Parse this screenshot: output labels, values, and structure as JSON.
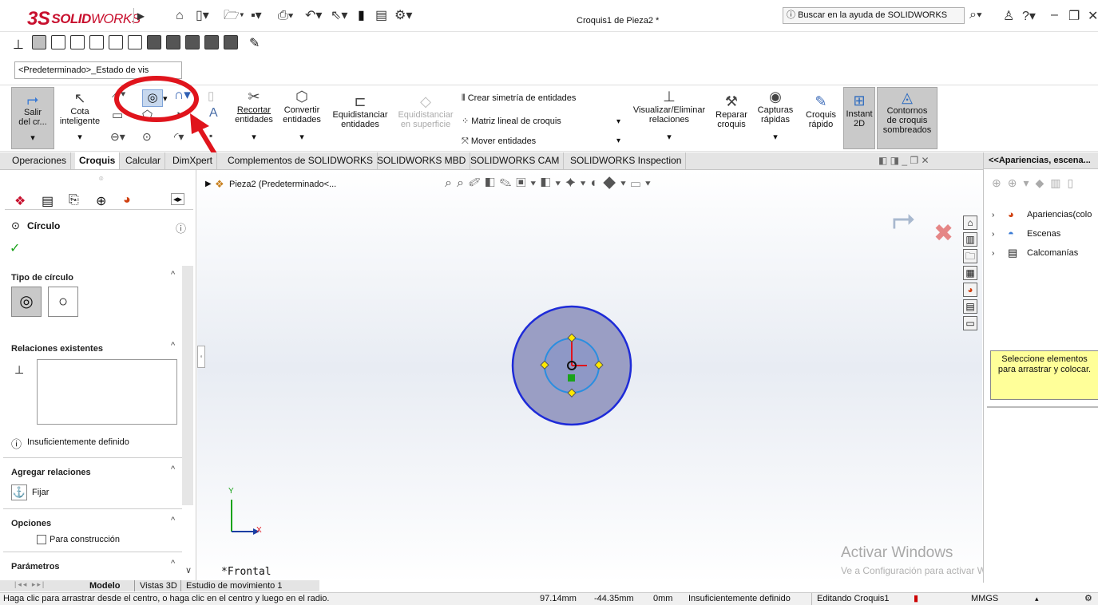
{
  "titlebar": {
    "logo_ds": "3S",
    "logo_solid": "SOLID",
    "logo_works": "WORKS",
    "document_title": "Croquis1 de Pieza2 *",
    "help_search_placeholder": "Buscar en la ayuda de SOLIDWORKS"
  },
  "config_selector": {
    "value": "<Predeterminado>_Estado de vis"
  },
  "ribbon": {
    "salir_croquis": [
      "Salir",
      "del cr..."
    ],
    "cota_inteligente": [
      "Cota",
      "inteligente"
    ],
    "recortar": [
      "Recortar",
      "entidades"
    ],
    "convertir": [
      "Convertir",
      "entidades"
    ],
    "equidistanciar": [
      "Equidistanciar",
      "entidades"
    ],
    "equidistanciar_superficie": [
      "Equidistanciar",
      "en superficie"
    ],
    "simetria": "Crear simetría de entidades",
    "matriz": "Matriz lineal de croquis",
    "mover": "Mover entidades",
    "visualizar": [
      "Visualizar/Eliminar",
      "relaciones"
    ],
    "reparar": [
      "Reparar",
      "croquis"
    ],
    "capturas": [
      "Capturas",
      "rápidas"
    ],
    "croquis_rapido": [
      "Croquis",
      "rápido"
    ],
    "instant2d": [
      "Instant",
      "2D"
    ],
    "contornos": [
      "Contornos",
      "de croquis",
      "sombreados"
    ]
  },
  "tabs": [
    "Operaciones",
    "Croquis",
    "Calcular",
    "DimXpert",
    "Complementos de SOLIDWORKS",
    "SOLIDWORKS MBD",
    "SOLIDWORKS CAM",
    "SOLIDWORKS Inspection"
  ],
  "active_tab": "Croquis",
  "property_manager": {
    "title": "Círculo",
    "tipo_circulo": "Tipo de círculo",
    "relaciones_existentes": "Relaciones existentes",
    "estado": "Insuficientemente definido",
    "agregar_relaciones": "Agregar relaciones",
    "fijar": "Fijar",
    "opciones": "Opciones",
    "para_construccion": "Para construcción",
    "parametros": "Parámetros"
  },
  "viewport": {
    "tree_item": "Pieza2  (Predeterminado<...",
    "view_label": "*Frontal",
    "axis_x": "X",
    "axis_y": "Y",
    "watermark_title": "Activar Windows",
    "watermark_sub": "Ve a Configuración para activar Windows."
  },
  "task_pane": {
    "header": "<<Apariencias, escena...",
    "items": [
      "Apariencias(colo",
      "Escenas",
      "Calcomanías"
    ],
    "tooltip": "Seleccione elementos para arrastrar y colocar."
  },
  "bottom_tabs": [
    "Modelo",
    "Vistas 3D",
    "Estudio de movimiento 1"
  ],
  "status": {
    "hint": "Haga clic para arrastrar desde el centro, o haga clic en el centro y luego en el radio.",
    "x": "97.14mm",
    "y": "-44.35mm",
    "z": "0mm",
    "state": "Insuficientemente definido",
    "editing": "Editando Croquis1",
    "units": "MMGS"
  },
  "colors": {
    "brand": "#c8102e",
    "annotation_red": "#e0141c",
    "circle_outer": "#1e2bd8",
    "circle_fill": "#9a9ec4",
    "tooltip_bg": "#ffff99"
  }
}
